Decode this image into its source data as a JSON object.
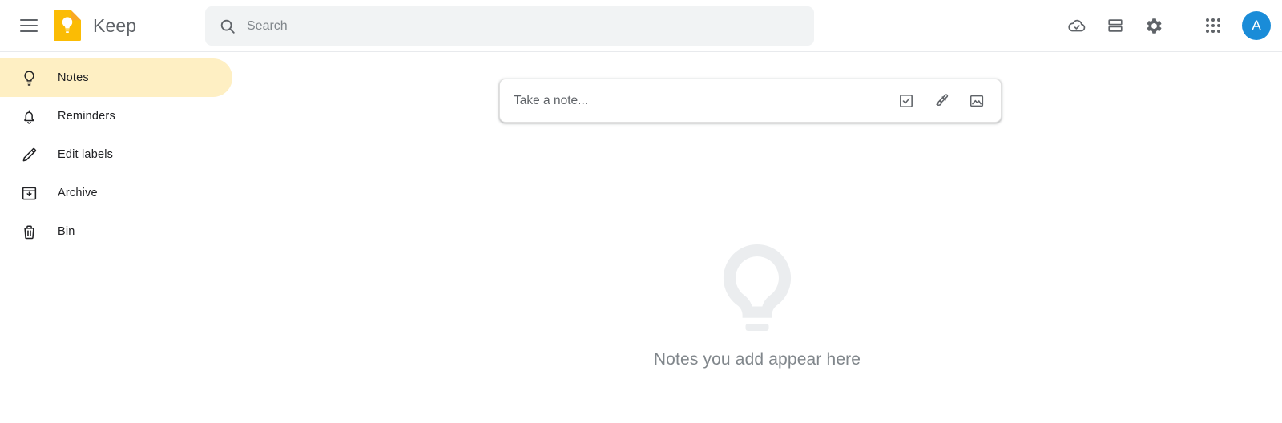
{
  "app": {
    "name": "Keep",
    "accent_yellow": "#fbbc04",
    "active_pill_color": "#feefc3",
    "avatar_color": "#1a8cd8",
    "icon_color": "#5f6368"
  },
  "header": {
    "menu_icon": "hamburger-menu-icon",
    "logo_icon": "keep-logo-icon",
    "title": "Keep",
    "search": {
      "icon": "search-icon",
      "placeholder": "Search",
      "value": ""
    },
    "actions": [
      {
        "icon": "cloud-check-icon",
        "label": "Refresh"
      },
      {
        "icon": "list-view-icon",
        "label": "List view"
      },
      {
        "icon": "gear-icon",
        "label": "Settings"
      }
    ],
    "apps_icon": "apps-grid-icon",
    "avatar": {
      "initial": "A",
      "icon": "avatar"
    }
  },
  "sidebar": {
    "items": [
      {
        "label": "Notes",
        "icon": "lightbulb-icon",
        "active": true
      },
      {
        "label": "Reminders",
        "icon": "bell-icon",
        "active": false
      },
      {
        "label": "Edit labels",
        "icon": "pencil-icon",
        "active": false
      },
      {
        "label": "Archive",
        "icon": "archive-icon",
        "active": false
      },
      {
        "label": "Bin",
        "icon": "trash-icon",
        "active": false
      }
    ]
  },
  "main": {
    "composer": {
      "placeholder": "Take a note...",
      "value": "",
      "actions": [
        {
          "icon": "checkbox-icon",
          "label": "New list"
        },
        {
          "icon": "brush-icon",
          "label": "New note with drawing"
        },
        {
          "icon": "image-icon",
          "label": "New note with image"
        }
      ]
    },
    "empty_state": {
      "icon": "lightbulb-large-icon",
      "text": "Notes you add appear here"
    }
  }
}
